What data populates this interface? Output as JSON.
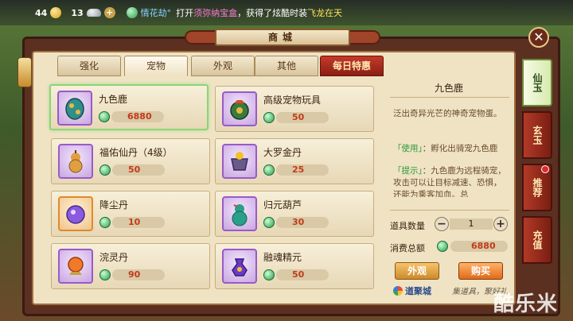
{
  "topbar": {
    "gold_count": "44",
    "silver_count": "13",
    "chat": {
      "sender": "情花劫°",
      "text_1": "打开",
      "highlight_1": "须弥纳宝盒",
      "text_2": "，获得了炫酷时装",
      "highlight_2": "飞龙在天"
    }
  },
  "window": {
    "title": "商城"
  },
  "tabs": [
    {
      "label": "强化"
    },
    {
      "label": "宠物"
    },
    {
      "label": "外观"
    },
    {
      "label": "其他"
    },
    {
      "label": "每日特惠"
    }
  ],
  "items": [
    {
      "name": "九色鹿",
      "price": "6880"
    },
    {
      "name": "高级宠物玩具",
      "price": "50"
    },
    {
      "name": "福佑仙丹（4级）",
      "price": "50"
    },
    {
      "name": "大罗金丹",
      "price": "25"
    },
    {
      "name": "降尘丹",
      "price": "10"
    },
    {
      "name": "归元葫芦",
      "price": "30"
    },
    {
      "name": "浣灵丹",
      "price": "90"
    },
    {
      "name": "融魂精元",
      "price": "50"
    }
  ],
  "detail": {
    "title": "九色鹿",
    "desc": "泛出奇异光芒的神奇宠物蛋。",
    "use_tag": "「使用」",
    "use_text": "：孵化出骑宠九色鹿",
    "tip_tag": "「提示」",
    "tip_text": "：九色鹿为远程骑宠，攻击可以让目标减速、恐惧，还能为乘客加血。总",
    "qty_label": "道具数量",
    "qty_value": "1",
    "total_label": "消费总额",
    "total_value": "6880",
    "btn_look": "外观",
    "btn_buy": "购买",
    "logo_text": "道聚城",
    "sign_text": "集道具，聚好礼"
  },
  "side_tabs": [
    {
      "label": "仙玉"
    },
    {
      "label": "玄玉"
    },
    {
      "label": "推荐"
    },
    {
      "label": "充值"
    }
  ],
  "watermark": "酷乐米"
}
